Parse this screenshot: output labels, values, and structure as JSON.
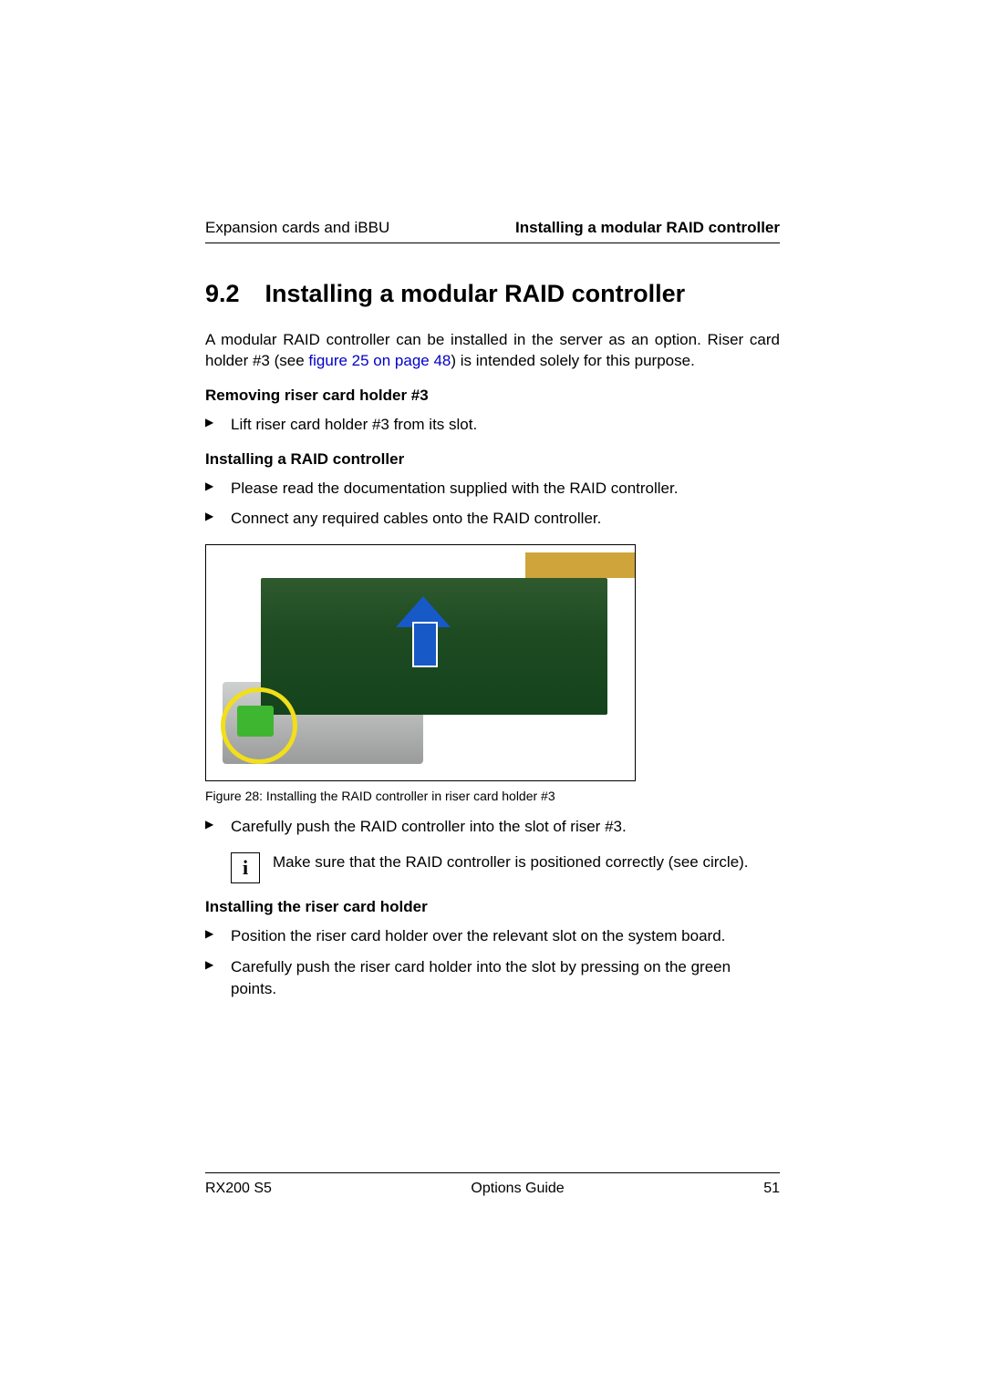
{
  "header": {
    "left": "Expansion cards and iBBU",
    "right": "Installing a modular RAID controller"
  },
  "section": {
    "number": "9.2",
    "title": "Installing a modular RAID controller"
  },
  "intro": {
    "pre_link": "A modular RAID controller can be installed in the server as an option. Riser card holder #3 (see ",
    "link_text": "figure 25 on page 48",
    "post_link": ") is intended solely for this purpose."
  },
  "sub1": {
    "title": "Removing riser card holder #3",
    "steps": [
      "Lift riser card holder #3 from its slot."
    ]
  },
  "sub2": {
    "title": "Installing a RAID controller",
    "steps_before_figure": [
      "Please read the documentation supplied with the RAID controller.",
      "Connect any required cables onto the RAID controller."
    ],
    "caption": "Figure 28: Installing the RAID controller in riser card holder #3",
    "steps_after_figure": [
      "Carefully push the RAID controller into the slot of riser #3."
    ],
    "info": "Make sure that the RAID controller is positioned correctly (see circle)."
  },
  "sub3": {
    "title": "Installing the riser card holder",
    "steps": [
      "Position the riser card holder over the relevant slot on the system board.",
      "Carefully push the riser card holder into the slot by pressing on the green points."
    ]
  },
  "footer": {
    "left": "RX200 S5",
    "center": "Options Guide",
    "right": "51"
  }
}
